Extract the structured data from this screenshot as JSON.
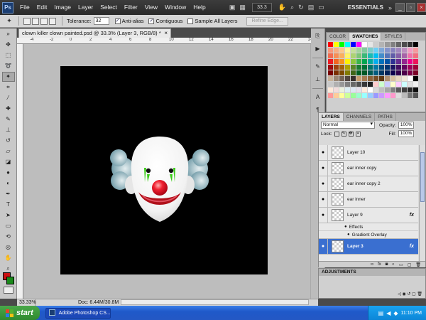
{
  "app": {
    "logo_text": "Ps",
    "menu": [
      "File",
      "Edit",
      "Image",
      "Layer",
      "Select",
      "Filter",
      "View",
      "Window",
      "Help"
    ],
    "zoom_display": "33.3",
    "workspace": "ESSENTIALS"
  },
  "options_bar": {
    "tolerance_label": "Tolerance:",
    "tolerance_value": "32",
    "anti_alias_label": "Anti-alias",
    "contiguous_label": "Contiguous",
    "sample_all_layers_label": "Sample All Layers",
    "refine_edge_label": "Refine Edge..."
  },
  "document": {
    "tab_title": "clown killer clown painted.psd @ 33.3% (Layer 3, RGB/8) *",
    "zoom_level": "33.33%",
    "doc_info": "Doc: 6.44M/30.8M",
    "ruler_numbers": [
      "-4",
      "-2",
      "0",
      "2",
      "4",
      "6",
      "8",
      "10",
      "12",
      "14",
      "16",
      "18",
      "20",
      "22",
      "24"
    ]
  },
  "swatches_panel": {
    "tabs": [
      "COLOR",
      "SWATCHES",
      "STYLES"
    ]
  },
  "layers_panel": {
    "tabs": [
      "LAYERS",
      "CHANNELS",
      "PATHS"
    ],
    "blend_mode": "Normal",
    "opacity_label": "Opacity:",
    "opacity_value": "100%",
    "lock_label": "Lock:",
    "fill_label": "Fill:",
    "fill_value": "100%",
    "layers": [
      {
        "name": "Layer 10"
      },
      {
        "name": "ear inner copy"
      },
      {
        "name": "ear inner copy 2"
      },
      {
        "name": "ear inner"
      },
      {
        "name": "Layer 9",
        "fx": "fx"
      },
      {
        "name": "Layer 3",
        "fx": "fx"
      }
    ],
    "effects_label": "Effects",
    "gradient_overlay_label": "Gradient Overlay"
  },
  "adjustments_panel": {
    "title": "ADJUSTMENTS"
  },
  "taskbar": {
    "start_label": "start",
    "task_label": "Adobe Photoshop CS...",
    "clock": "11:10 PM"
  },
  "colors": {
    "foreground": "#cc1111",
    "background": "#1a8a1a",
    "selected_layer": "#3a6fd0",
    "taskbar": "#2458c4"
  }
}
